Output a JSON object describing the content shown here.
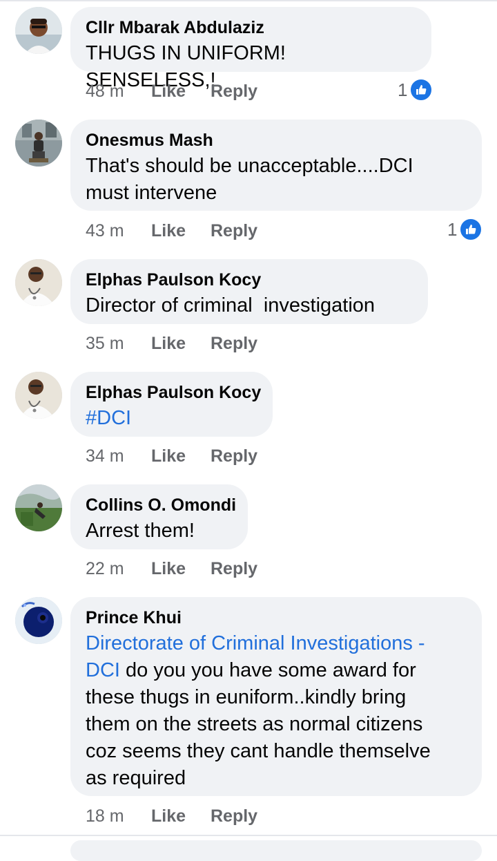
{
  "comments": [
    {
      "author": "Cllr Mbarak Abdulaziz",
      "text": "THUGS IN UNIFORM! SENSELESS,!",
      "time": "48 m",
      "like": "Like",
      "reply": "Reply",
      "reaction_count": "1",
      "reaction_icon": "like-thumb-icon"
    },
    {
      "author": "Onesmus Mash",
      "text_line1": "That's should be unacceptable....DCI",
      "text_line2": "must intervene",
      "time": "43 m",
      "like": "Like",
      "reply": "Reply",
      "reaction_count": "1",
      "reaction_icon": "like-thumb-icon"
    },
    {
      "author": "Elphas Paulson Kocy",
      "text": "Director of criminal  investigation",
      "time": "35 m",
      "like": "Like",
      "reply": "Reply"
    },
    {
      "author": "Elphas Paulson Kocy",
      "text": "#DCI",
      "time": "34 m",
      "like": "Like",
      "reply": "Reply"
    },
    {
      "author": "Collins O. Omondi",
      "text": "Arrest them!",
      "time": "22 m",
      "like": "Like",
      "reply": "Reply"
    },
    {
      "author": "Prince Khui",
      "mention_line1": "Directorate of Criminal Investigations -",
      "mention_line2": "DCI",
      "text_line2_rest": " do you you have some award for",
      "text_line3": "these thugs in euniform..kindly bring",
      "text_line4": "them on the streets as normal citizens",
      "text_line5": "coz seems they cant handle themselve",
      "text_line6": "as required",
      "time": "18 m",
      "like": "Like",
      "reply": "Reply"
    }
  ],
  "colors": {
    "bubble": "#f0f2f5",
    "link": "#216fdb",
    "meta": "#65676b",
    "like_icon": "#1b74e4"
  }
}
